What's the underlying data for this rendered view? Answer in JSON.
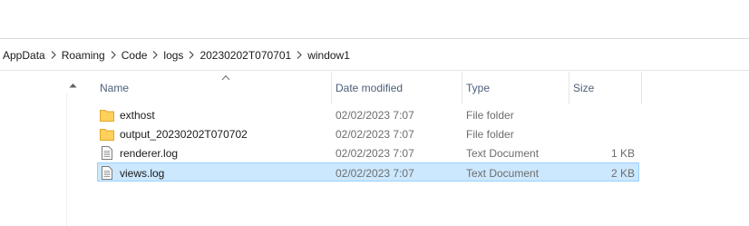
{
  "breadcrumb": {
    "items": [
      "AppData",
      "Roaming",
      "Code",
      "logs",
      "20230202T070701",
      "window1"
    ]
  },
  "columns": {
    "name": "Name",
    "date_modified": "Date modified",
    "type": "Type",
    "size": "Size"
  },
  "files": [
    {
      "name": "exthost",
      "date": "02/02/2023 7:07",
      "type": "File folder",
      "size": "",
      "icon": "folder-icon"
    },
    {
      "name": "output_20230202T070702",
      "date": "02/02/2023 7:07",
      "type": "File folder",
      "size": "",
      "icon": "folder-icon"
    },
    {
      "name": "renderer.log",
      "date": "02/02/2023 7:07",
      "type": "Text Document",
      "size": "1 KB",
      "icon": "text-document-icon"
    },
    {
      "name": "views.log",
      "date": "02/02/2023 7:07",
      "type": "Text Document",
      "size": "2 KB",
      "icon": "text-document-icon",
      "selected": true
    }
  ],
  "colors": {
    "selection_bg": "#cce8ff",
    "selection_border": "#99d1ff",
    "folder": "#ffd05a",
    "header_text": "#4c607a"
  }
}
